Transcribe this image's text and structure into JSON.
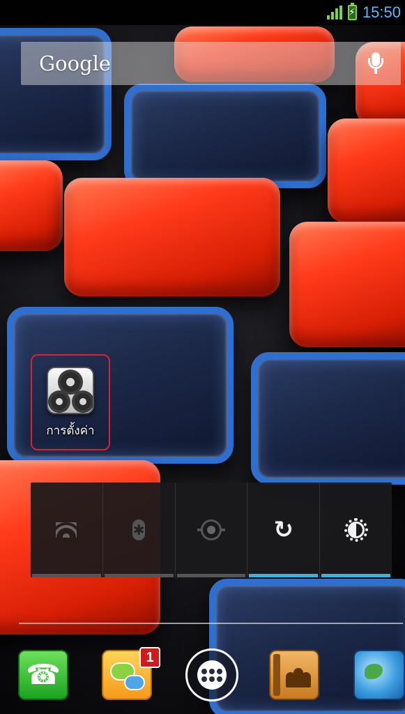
{
  "status_bar": {
    "time": "15:50",
    "signal_icon": "signal-icon",
    "battery_icon": "battery-charging-icon"
  },
  "search_widget": {
    "logo_text": "Google",
    "mic_icon": "mic-icon"
  },
  "shortcuts": [
    {
      "label": "การตั้งค่า",
      "icon": "settings-gears-icon",
      "highlighted": true,
      "highlight_color": "#e02030"
    }
  ],
  "power_widget": {
    "toggles": [
      {
        "name": "wifi",
        "icon": "wifi-icon",
        "state": "off"
      },
      {
        "name": "bluetooth",
        "icon": "bluetooth-icon",
        "state": "off"
      },
      {
        "name": "gps",
        "icon": "gps-icon",
        "state": "off"
      },
      {
        "name": "sync",
        "icon": "sync-icon",
        "state": "on"
      },
      {
        "name": "brightness",
        "icon": "brightness-icon",
        "state": "on"
      }
    ],
    "active_color": "#33b5e5"
  },
  "dock": {
    "apps": [
      {
        "name": "phone",
        "icon": "phone-icon"
      },
      {
        "name": "messaging",
        "icon": "messaging-icon",
        "badge": "1"
      },
      {
        "name": "app-drawer",
        "icon": "app-grid-icon"
      },
      {
        "name": "contacts",
        "icon": "contacts-icon"
      },
      {
        "name": "browser",
        "icon": "globe-icon"
      }
    ]
  },
  "colors": {
    "clock": "#59b9ff",
    "badge": "#d11a1a",
    "wallpaper_red": "#ff3b1a",
    "wallpaper_blue": "#2f6fd0"
  }
}
